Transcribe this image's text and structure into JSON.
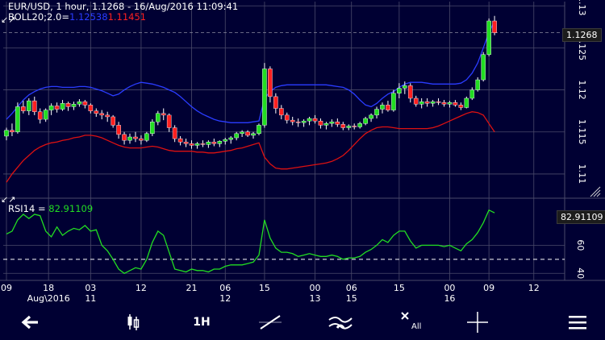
{
  "header": {
    "title": "EUR/USD, 1 hour, 1.1268 - 16/Aug/2016 11:09:41",
    "boll_prefix": "BOLL20;2.0=",
    "boll_upper": "1.12538",
    "boll_lower": "1.11451",
    "rsi_prefix": "RSI14 = ",
    "rsi_value": "82.91109"
  },
  "price_tag": "1.1268",
  "rsi_tag": "82.91109",
  "colors": {
    "background": "#000033",
    "grid": "#4a4a6a",
    "bull": "#22dd22",
    "bear": "#ff2020",
    "boll_upper": "#2a3cff",
    "boll_lower": "#dd1111",
    "rsi_line": "#22dd22",
    "text": "#ffffff"
  },
  "toolbar": {
    "interval_label": "1H",
    "all_label": "All",
    "icons": [
      "back-arrow-icon",
      "candlestick-icon",
      "interval-icon",
      "line-draw-icon",
      "indicator-icon",
      "delete-all-icon",
      "crosshair-icon",
      "menu-icon"
    ]
  },
  "chart_data": [
    {
      "type": "candlestick",
      "title": "EUR/USD, 1 hour",
      "ylim": [
        1.1075,
        1.1305
      ],
      "y_ticks": [
        "1.11",
        "1.115",
        "1.12",
        "1.125",
        "1.13"
      ],
      "last_price": 1.1268,
      "x_ticks": [
        {
          "label": "09",
          "sub": ""
        },
        {
          "label": "18",
          "sub": "Aug\\2016"
        },
        {
          "label": "03",
          "sub": "11"
        },
        {
          "label": "12",
          "sub": ""
        },
        {
          "label": "21",
          "sub": ""
        },
        {
          "label": "06",
          "sub": "12"
        },
        {
          "label": "15",
          "sub": ""
        },
        {
          "label": "00",
          "sub": "13"
        },
        {
          "label": "06",
          "sub": "15"
        },
        {
          "label": "15",
          "sub": ""
        },
        {
          "label": "00",
          "sub": "16"
        },
        {
          "label": "09",
          "sub": ""
        },
        {
          "label": "12",
          "sub": ""
        }
      ],
      "candles": [
        [
          1.1145,
          1.1155,
          1.114,
          1.1152
        ],
        [
          1.1152,
          1.116,
          1.1145,
          1.115
        ],
        [
          1.115,
          1.1185,
          1.1148,
          1.118
        ],
        [
          1.118,
          1.1187,
          1.1172,
          1.1175
        ],
        [
          1.1175,
          1.119,
          1.117,
          1.1187
        ],
        [
          1.1187,
          1.1192,
          1.117,
          1.1174
        ],
        [
          1.1174,
          1.1178,
          1.116,
          1.1165
        ],
        [
          1.1165,
          1.1178,
          1.1162,
          1.1176
        ],
        [
          1.1176,
          1.1184,
          1.117,
          1.1181
        ],
        [
          1.1181,
          1.1185,
          1.1173,
          1.1177
        ],
        [
          1.1177,
          1.1188,
          1.1175,
          1.1184
        ],
        [
          1.1184,
          1.1186,
          1.1175,
          1.118
        ],
        [
          1.118,
          1.1186,
          1.1176,
          1.1183
        ],
        [
          1.1183,
          1.1189,
          1.118,
          1.1186
        ],
        [
          1.1186,
          1.1188,
          1.1178,
          1.1182
        ],
        [
          1.1182,
          1.1184,
          1.1172,
          1.1175
        ],
        [
          1.1175,
          1.1178,
          1.1168,
          1.1172
        ],
        [
          1.1172,
          1.1176,
          1.1165,
          1.117
        ],
        [
          1.117,
          1.1174,
          1.1162,
          1.1168
        ],
        [
          1.1168,
          1.117,
          1.1155,
          1.1158
        ],
        [
          1.1158,
          1.1162,
          1.1142,
          1.1147
        ],
        [
          1.1147,
          1.115,
          1.1135,
          1.114
        ],
        [
          1.114,
          1.1148,
          1.1136,
          1.1144
        ],
        [
          1.1144,
          1.115,
          1.1138,
          1.1142
        ],
        [
          1.1142,
          1.1146,
          1.1135,
          1.114
        ],
        [
          1.114,
          1.115,
          1.1138,
          1.1148
        ],
        [
          1.1148,
          1.1165,
          1.1145,
          1.1162
        ],
        [
          1.1162,
          1.1175,
          1.1158,
          1.1172
        ],
        [
          1.1172,
          1.1178,
          1.1164,
          1.117
        ],
        [
          1.117,
          1.1172,
          1.115,
          1.1155
        ],
        [
          1.1155,
          1.1158,
          1.1138,
          1.1142
        ],
        [
          1.1142,
          1.1145,
          1.1134,
          1.1138
        ],
        [
          1.1138,
          1.1142,
          1.1132,
          1.1136
        ],
        [
          1.1136,
          1.114,
          1.113,
          1.1134
        ],
        [
          1.1134,
          1.1138,
          1.113,
          1.1136
        ],
        [
          1.1136,
          1.114,
          1.1132,
          1.1135
        ],
        [
          1.1135,
          1.114,
          1.1131,
          1.1138
        ],
        [
          1.1138,
          1.1142,
          1.1133,
          1.1136
        ],
        [
          1.1136,
          1.114,
          1.1132,
          1.1139
        ],
        [
          1.1139,
          1.1143,
          1.1135,
          1.1141
        ],
        [
          1.1141,
          1.1145,
          1.1136,
          1.1143
        ],
        [
          1.1143,
          1.115,
          1.114,
          1.1148
        ],
        [
          1.1148,
          1.1152,
          1.1144,
          1.115
        ],
        [
          1.115,
          1.1152,
          1.1144,
          1.1146
        ],
        [
          1.1146,
          1.115,
          1.1142,
          1.1148
        ],
        [
          1.1148,
          1.116,
          1.1146,
          1.1158
        ],
        [
          1.1158,
          1.1232,
          1.1155,
          1.1225
        ],
        [
          1.1225,
          1.1228,
          1.1185,
          1.1192
        ],
        [
          1.1192,
          1.1196,
          1.1172,
          1.1178
        ],
        [
          1.1178,
          1.1182,
          1.1165,
          1.117
        ],
        [
          1.117,
          1.1173,
          1.116,
          1.1164
        ],
        [
          1.1164,
          1.1168,
          1.1158,
          1.1162
        ],
        [
          1.1162,
          1.1166,
          1.1156,
          1.1161
        ],
        [
          1.1161,
          1.1165,
          1.1156,
          1.1163
        ],
        [
          1.1163,
          1.1168,
          1.1158,
          1.1166
        ],
        [
          1.1166,
          1.117,
          1.116,
          1.1163
        ],
        [
          1.1163,
          1.1166,
          1.1154,
          1.1158
        ],
        [
          1.1158,
          1.1162,
          1.1153,
          1.116
        ],
        [
          1.116,
          1.1165,
          1.1156,
          1.1162
        ],
        [
          1.1162,
          1.1166,
          1.1156,
          1.1159
        ],
        [
          1.1159,
          1.1162,
          1.1152,
          1.1155
        ],
        [
          1.1155,
          1.1159,
          1.1152,
          1.1157
        ],
        [
          1.1157,
          1.116,
          1.1153,
          1.1156
        ],
        [
          1.1156,
          1.1162,
          1.1154,
          1.116
        ],
        [
          1.116,
          1.1168,
          1.1158,
          1.1166
        ],
        [
          1.1166,
          1.1172,
          1.1162,
          1.117
        ],
        [
          1.117,
          1.118,
          1.1166,
          1.1177
        ],
        [
          1.1177,
          1.1185,
          1.1172,
          1.1182
        ],
        [
          1.1182,
          1.1187,
          1.1174,
          1.1176
        ],
        [
          1.1176,
          1.12,
          1.1174,
          1.1196
        ],
        [
          1.1196,
          1.1208,
          1.119,
          1.1202
        ],
        [
          1.1202,
          1.121,
          1.1195,
          1.1205
        ],
        [
          1.1205,
          1.1208,
          1.1185,
          1.119
        ],
        [
          1.119,
          1.1193,
          1.118,
          1.1183
        ],
        [
          1.1183,
          1.119,
          1.1178,
          1.1186
        ],
        [
          1.1186,
          1.119,
          1.118,
          1.1184
        ],
        [
          1.1184,
          1.1188,
          1.118,
          1.1186
        ],
        [
          1.1186,
          1.119,
          1.1182,
          1.1185
        ],
        [
          1.1185,
          1.1188,
          1.118,
          1.1183
        ],
        [
          1.1183,
          1.1187,
          1.1179,
          1.1185
        ],
        [
          1.1185,
          1.1188,
          1.118,
          1.1182
        ],
        [
          1.1182,
          1.1185,
          1.1176,
          1.1179
        ],
        [
          1.1179,
          1.1192,
          1.1178,
          1.119
        ],
        [
          1.119,
          1.1203,
          1.1188,
          1.12
        ],
        [
          1.12,
          1.1215,
          1.1198,
          1.1212
        ],
        [
          1.1212,
          1.1245,
          1.121,
          1.1242
        ],
        [
          1.1242,
          1.1285,
          1.124,
          1.1282
        ],
        [
          1.1282,
          1.1288,
          1.1265,
          1.1268
        ]
      ],
      "boll_upper": [
        1.1165,
        1.1172,
        1.118,
        1.1188,
        1.1194,
        1.1198,
        1.1201,
        1.1203,
        1.1204,
        1.1204,
        1.1203,
        1.1203,
        1.1203,
        1.1204,
        1.1204,
        1.1203,
        1.1201,
        1.1199,
        1.1196,
        1.1193,
        1.1195,
        1.12,
        1.1204,
        1.1207,
        1.1209,
        1.1208,
        1.1207,
        1.1205,
        1.1203,
        1.12,
        1.1197,
        1.1192,
        1.1186,
        1.118,
        1.1175,
        1.1171,
        1.1168,
        1.1165,
        1.1163,
        1.1162,
        1.1161,
        1.1161,
        1.1161,
        1.1161,
        1.1162,
        1.1163,
        1.119,
        1.1198,
        1.1203,
        1.1205,
        1.1206,
        1.1206,
        1.1206,
        1.1206,
        1.1206,
        1.1206,
        1.1206,
        1.1206,
        1.1205,
        1.1204,
        1.1203,
        1.12,
        1.1195,
        1.1188,
        1.1182,
        1.118,
        1.1184,
        1.119,
        1.1195,
        1.1198,
        1.1203,
        1.1207,
        1.1209,
        1.1209,
        1.1209,
        1.1208,
        1.1207,
        1.1207,
        1.1207,
        1.1207,
        1.1207,
        1.1208,
        1.1212,
        1.122,
        1.1232,
        1.125,
        1.1268,
        1.1282
      ],
      "boll_lower": [
        1.109,
        1.11,
        1.1108,
        1.1116,
        1.1122,
        1.1128,
        1.1132,
        1.1135,
        1.1137,
        1.1138,
        1.114,
        1.1141,
        1.1143,
        1.1144,
        1.1146,
        1.1146,
        1.1145,
        1.1143,
        1.114,
        1.1137,
        1.1134,
        1.1132,
        1.1131,
        1.1131,
        1.1131,
        1.1132,
        1.1133,
        1.1132,
        1.113,
        1.1128,
        1.1127,
        1.1127,
        1.1127,
        1.1127,
        1.1126,
        1.1126,
        1.1125,
        1.1125,
        1.1126,
        1.1127,
        1.1128,
        1.113,
        1.1131,
        1.1133,
        1.1135,
        1.1137,
        1.112,
        1.1112,
        1.1107,
        1.1106,
        1.1106,
        1.1107,
        1.1108,
        1.1109,
        1.111,
        1.1111,
        1.1112,
        1.1113,
        1.1115,
        1.1118,
        1.1122,
        1.1128,
        1.1135,
        1.1142,
        1.1148,
        1.1152,
        1.1155,
        1.1156,
        1.1156,
        1.1155,
        1.1154,
        1.1154,
        1.1154,
        1.1154,
        1.1154,
        1.1154,
        1.1155,
        1.1157,
        1.116,
        1.1163,
        1.1166,
        1.1169,
        1.1172,
        1.1174,
        1.1173,
        1.117,
        1.116,
        1.115
      ]
    },
    {
      "type": "line",
      "title": "RSI14",
      "ylim": [
        35,
        90
      ],
      "y_ticks": [
        "40",
        "60"
      ],
      "reference_line": 50,
      "values": [
        68,
        70,
        78,
        82,
        79,
        82,
        81,
        70,
        66,
        73,
        67,
        70,
        72,
        71,
        74,
        70,
        71,
        60,
        56,
        50,
        43,
        40,
        42,
        44,
        43,
        50,
        62,
        70,
        67,
        55,
        43,
        42,
        41,
        43,
        42,
        42,
        41,
        43,
        43,
        45,
        46,
        46,
        46,
        47,
        48,
        53,
        78,
        65,
        58,
        55,
        55,
        54,
        52,
        53,
        54,
        53,
        52,
        52,
        53,
        52,
        50,
        51,
        51,
        52,
        55,
        57,
        60,
        64,
        62,
        67,
        70,
        70,
        63,
        58,
        60,
        60,
        60,
        60,
        59,
        60,
        58,
        56,
        61,
        64,
        69,
        76,
        85,
        83
      ]
    }
  ]
}
